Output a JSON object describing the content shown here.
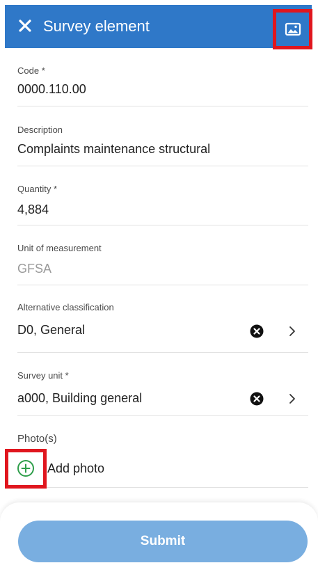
{
  "header": {
    "title": "Survey element",
    "close_icon": "close-icon",
    "gallery_icon": "image-gallery-icon",
    "background_color": "#2f78c8",
    "highlight_color": "#e0161e"
  },
  "fields": {
    "code": {
      "label": "Code *",
      "value": "0000.110.00"
    },
    "description": {
      "label": "Description",
      "value": "Complaints maintenance structural"
    },
    "quantity": {
      "label": "Quantity *",
      "value": "4,884"
    },
    "unit": {
      "label": "Unit of measurement",
      "value": "GFSA"
    },
    "alt_classification": {
      "label": "Alternative classification",
      "value": "D0, General",
      "clear_icon": "clear-icon",
      "chevron_icon": "chevron-right-icon"
    },
    "survey_unit": {
      "label": "Survey unit *",
      "value": "a000, Building general",
      "clear_icon": "clear-icon",
      "chevron_icon": "chevron-right-icon"
    }
  },
  "photos": {
    "label": "Photo(s)",
    "add_label": "Add photo",
    "add_icon": "add-circle-icon",
    "add_icon_color": "#2e9e4a"
  },
  "footer": {
    "submit_label": "Submit",
    "submit_color": "#79aee0"
  }
}
